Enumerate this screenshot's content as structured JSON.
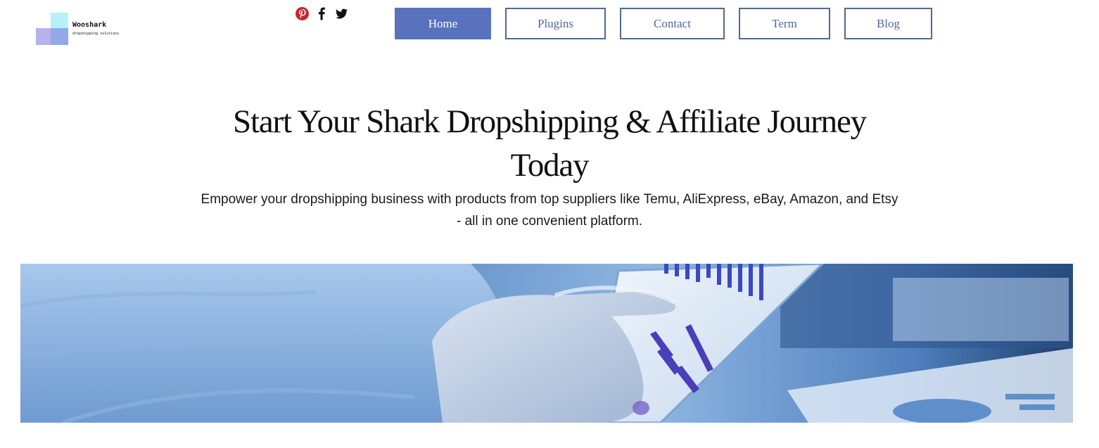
{
  "logo": {
    "name": "Wooshark",
    "tagline": "dropshipping solutions"
  },
  "social": [
    {
      "icon": "pinterest-icon",
      "color": "#c9252f"
    },
    {
      "icon": "facebook-icon",
      "color": "#111111"
    },
    {
      "icon": "twitter-icon",
      "color": "#111111"
    }
  ],
  "nav": {
    "items": [
      {
        "label": "Home",
        "active": true
      },
      {
        "label": "Plugins",
        "active": false
      },
      {
        "label": "Contact",
        "active": false
      },
      {
        "label": "Term",
        "active": false
      },
      {
        "label": "Blog",
        "active": false
      }
    ]
  },
  "hero": {
    "title": "Start Your Shark Dropshipping & Affiliate Journey Today",
    "subtitle": "Empower your dropshipping business with products from top suppliers like Temu, AliExpress, eBay, Amazon, and Etsy - all in one convenient platform."
  },
  "colors": {
    "accent": "#5872bd",
    "nav_border": "#50679a",
    "banner_tint": "#3f6fb0"
  }
}
